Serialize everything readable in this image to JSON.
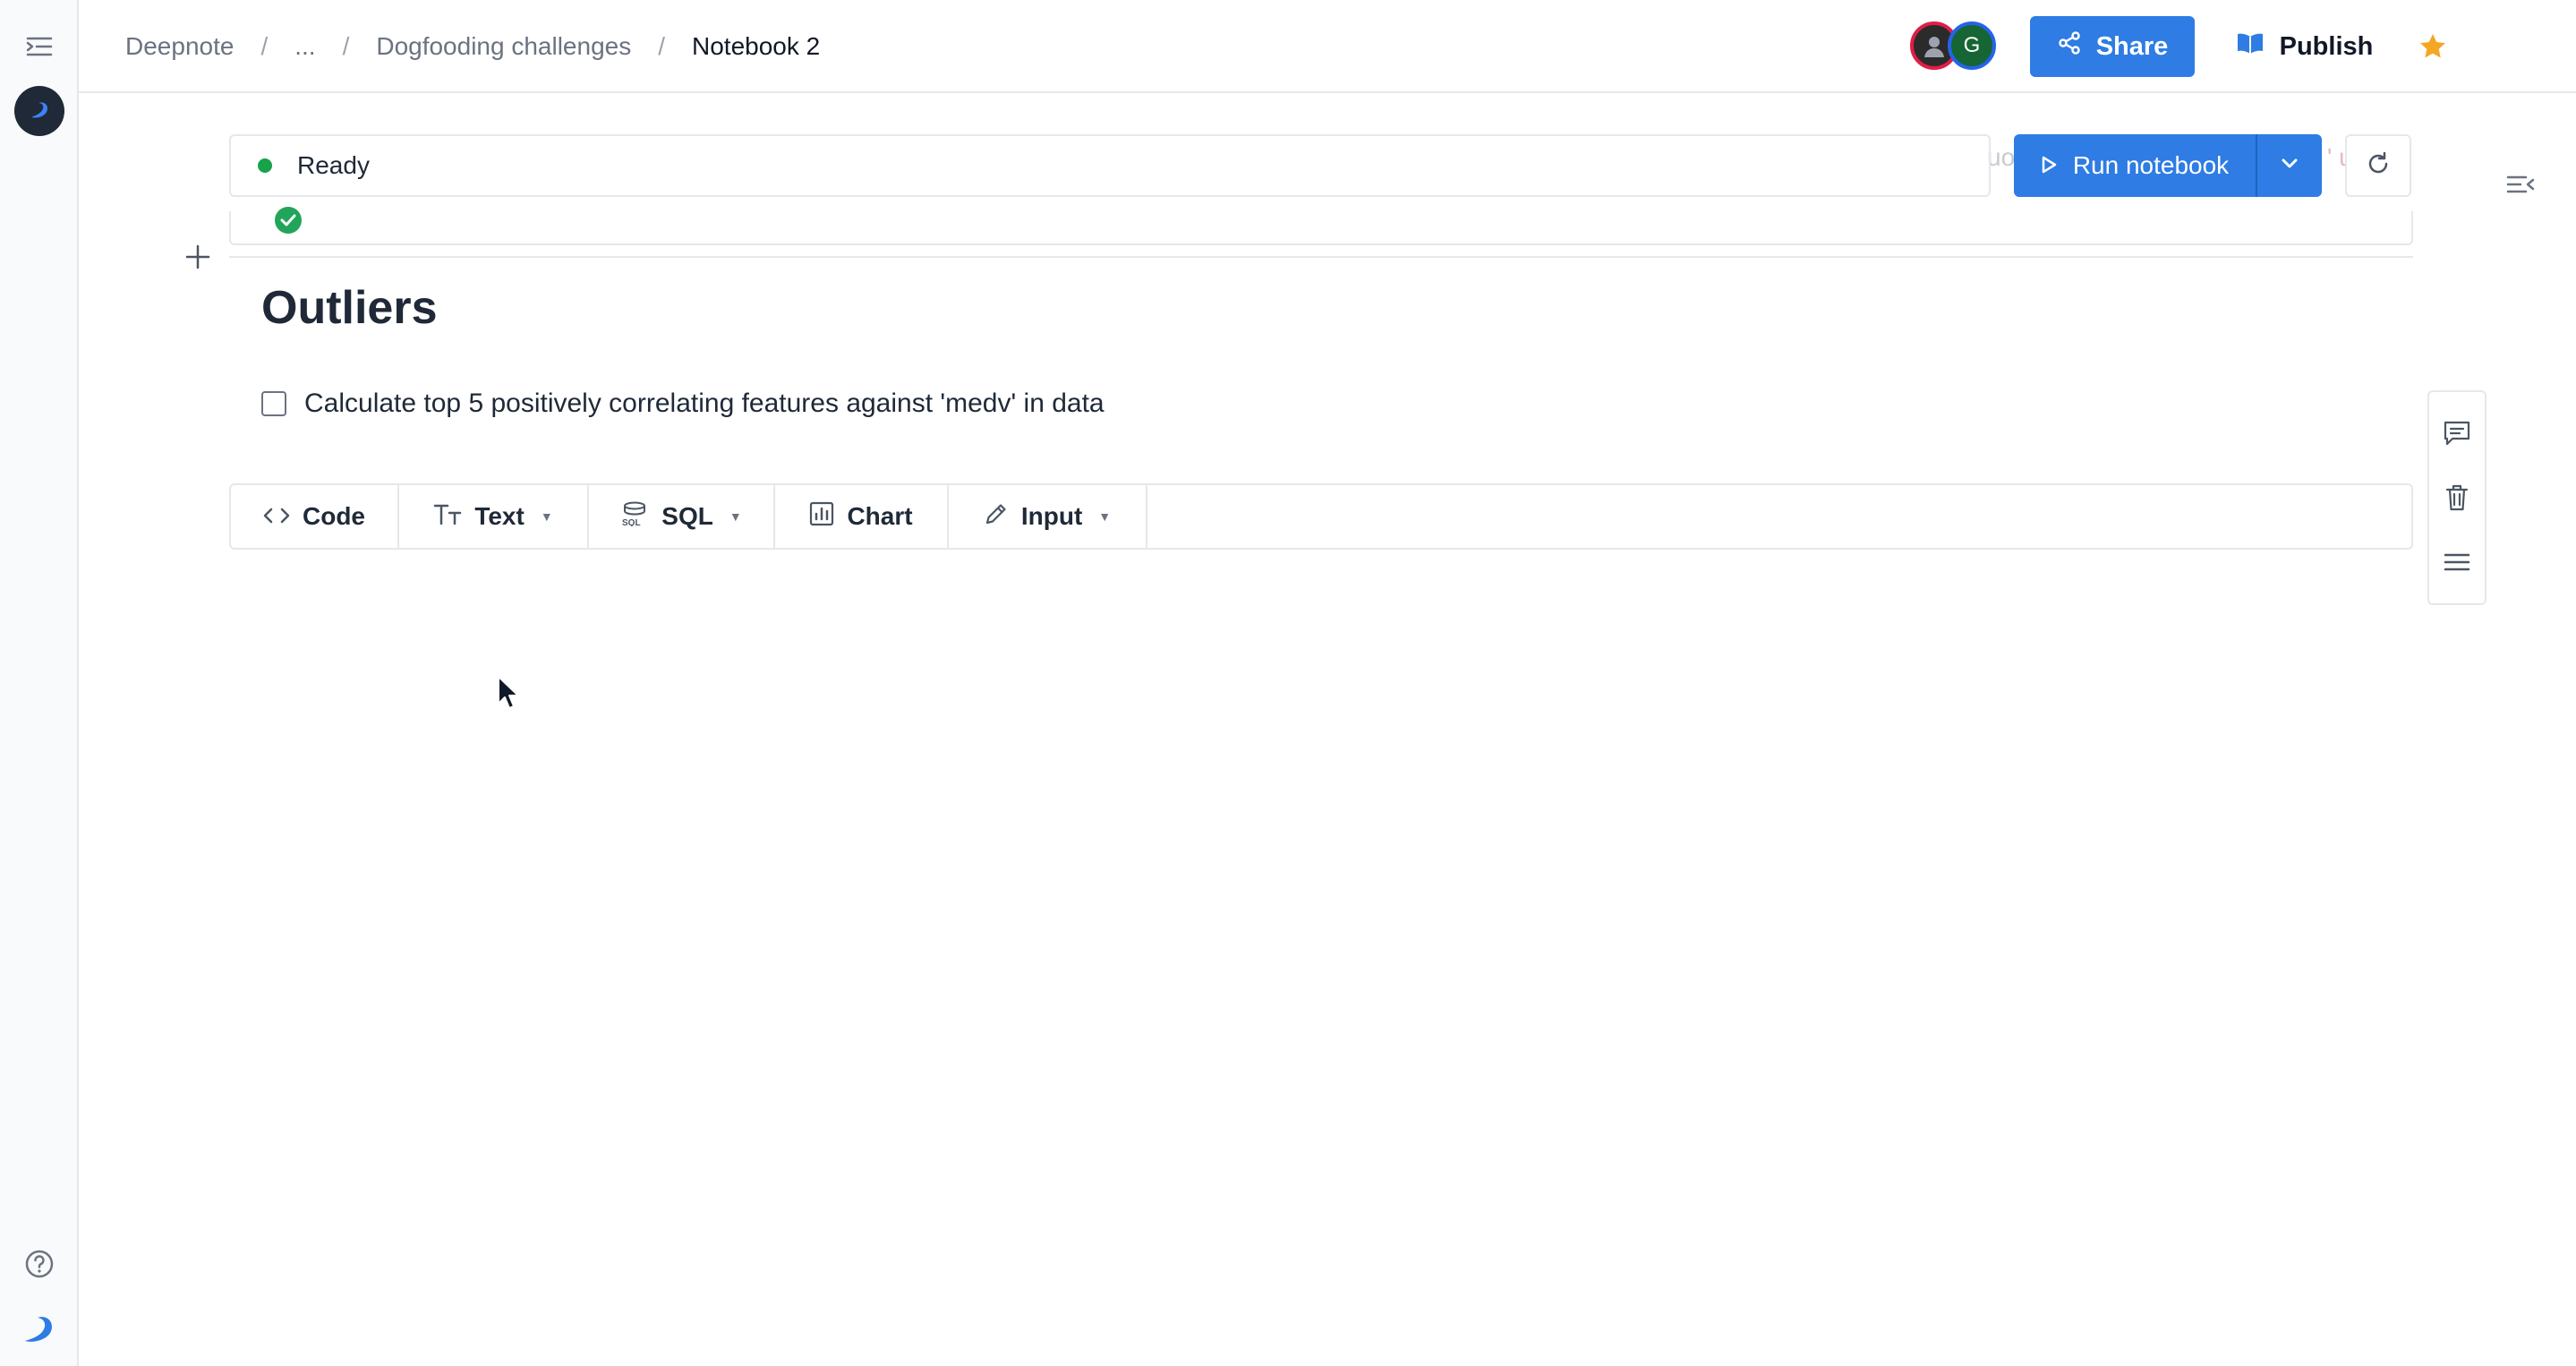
{
  "breadcrumb": {
    "root": "Deepnote",
    "ellipsis": "...",
    "project": "Dogfooding challenges",
    "notebook": "Notebook 2"
  },
  "header": {
    "avatar_initial": "G",
    "share_label": "Share",
    "publish_label": "Publish"
  },
  "status": {
    "text": "Ready",
    "ghost_left": "uo",
    "ghost_right": "' u"
  },
  "run": {
    "label": "Run notebook"
  },
  "content": {
    "heading": "Outliers",
    "todo_text": "Calculate top 5 positively correlating features against 'medv' in data",
    "todo_checked": false
  },
  "block_toolbar": {
    "code": "Code",
    "text": "Text",
    "sql": "SQL",
    "chart": "Chart",
    "input": "Input"
  },
  "colors": {
    "accent": "#2e7ce4",
    "status_ready": "#16a34a",
    "star": "#f5a623"
  },
  "icons": {
    "sidebar_toggle": "sidebar-toggle-icon",
    "share": "share-icon",
    "publish": "book-icon",
    "star": "star-icon",
    "more": "more-horizontal-icon",
    "run": "play-icon",
    "refresh": "refresh-icon",
    "comment": "comment-icon",
    "delete": "trash-icon",
    "menu": "menu-icon"
  }
}
